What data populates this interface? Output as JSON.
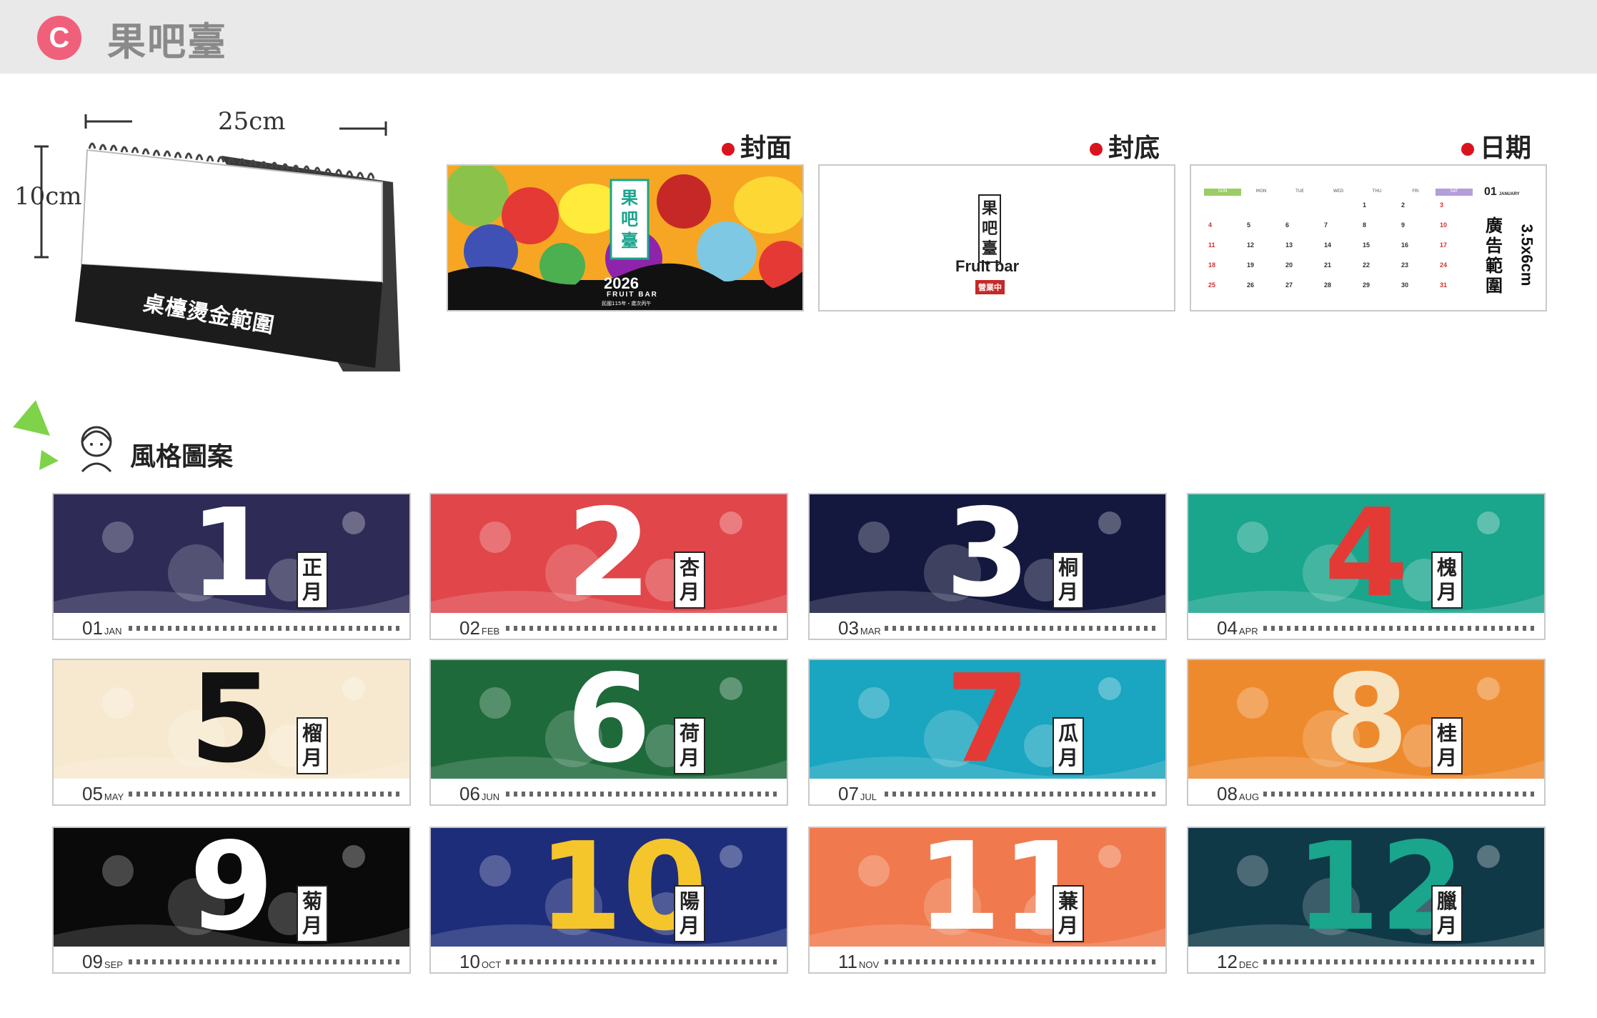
{
  "header": {
    "badge": "C",
    "title": "果吧臺"
  },
  "desk": {
    "width_label": "25cm",
    "height_label": "10cm",
    "base_text": "桌檯燙金範圍"
  },
  "sections": {
    "cover": "封面",
    "back": "封底",
    "dates": "日期"
  },
  "cover_card": {
    "logo": "果吧臺",
    "year": "2026",
    "name": "FRUIT BAR",
    "sub": "民國115年・歲次丙午"
  },
  "back_card": {
    "logo": "果吧臺",
    "name": "Fruit bar",
    "stamp": "營業中"
  },
  "date_card": {
    "month": "01",
    "month_en": "JANUARY",
    "ad_note": "廣告範圍",
    "ad_size": "3.5x6cm",
    "weekdays": [
      "SUN",
      "MON",
      "TUE",
      "WED",
      "THU",
      "FRI",
      "SAT"
    ],
    "rows": [
      [
        "",
        "",
        "",
        "",
        "1",
        "2",
        "3"
      ],
      [
        "4",
        "5",
        "6",
        "7",
        "8",
        "9",
        "10"
      ],
      [
        "11",
        "12",
        "13",
        "14",
        "15",
        "16",
        "17"
      ],
      [
        "18",
        "19",
        "20",
        "21",
        "22",
        "23",
        "24"
      ],
      [
        "25",
        "26",
        "27",
        "28",
        "29",
        "30",
        "31"
      ]
    ]
  },
  "style_heading": "風格圖案",
  "months": [
    {
      "num": "01",
      "abbr": "JAN",
      "big": "1",
      "label": "正月",
      "bg": "#2e2c57",
      "numcolor": "#ffffff"
    },
    {
      "num": "02",
      "abbr": "FEB",
      "big": "2",
      "label": "杏月",
      "bg": "#e0464a",
      "numcolor": "#ffffff"
    },
    {
      "num": "03",
      "abbr": "MAR",
      "big": "3",
      "label": "桐月",
      "bg": "#14183e",
      "numcolor": "#ffffff"
    },
    {
      "num": "04",
      "abbr": "APR",
      "big": "4",
      "label": "槐月",
      "bg": "#1aa58d",
      "numcolor": "#e43a35"
    },
    {
      "num": "05",
      "abbr": "MAY",
      "big": "5",
      "label": "榴月",
      "bg": "#f7e9cf",
      "numcolor": "#111111"
    },
    {
      "num": "06",
      "abbr": "JUN",
      "big": "6",
      "label": "荷月",
      "bg": "#1e6a3b",
      "numcolor": "#ffffff"
    },
    {
      "num": "07",
      "abbr": "JUL",
      "big": "7",
      "label": "瓜月",
      "bg": "#1aa5c0",
      "numcolor": "#e43a35"
    },
    {
      "num": "08",
      "abbr": "AUG",
      "big": "8",
      "label": "桂月",
      "bg": "#ee8a2e",
      "numcolor": "#f7e6c6"
    },
    {
      "num": "09",
      "abbr": "SEP",
      "big": "9",
      "label": "菊月",
      "bg": "#0a0a0a",
      "numcolor": "#ffffff"
    },
    {
      "num": "10",
      "abbr": "OCT",
      "big": "10",
      "label": "陽月",
      "bg": "#1e2d7a",
      "numcolor": "#f5c52c"
    },
    {
      "num": "11",
      "abbr": "NOV",
      "big": "11",
      "label": "蒹月",
      "bg": "#f07a4d",
      "numcolor": "#ffffff"
    },
    {
      "num": "12",
      "abbr": "DEC",
      "big": "12",
      "label": "臘月",
      "bg": "#103948",
      "numcolor": "#1aa58d"
    }
  ]
}
